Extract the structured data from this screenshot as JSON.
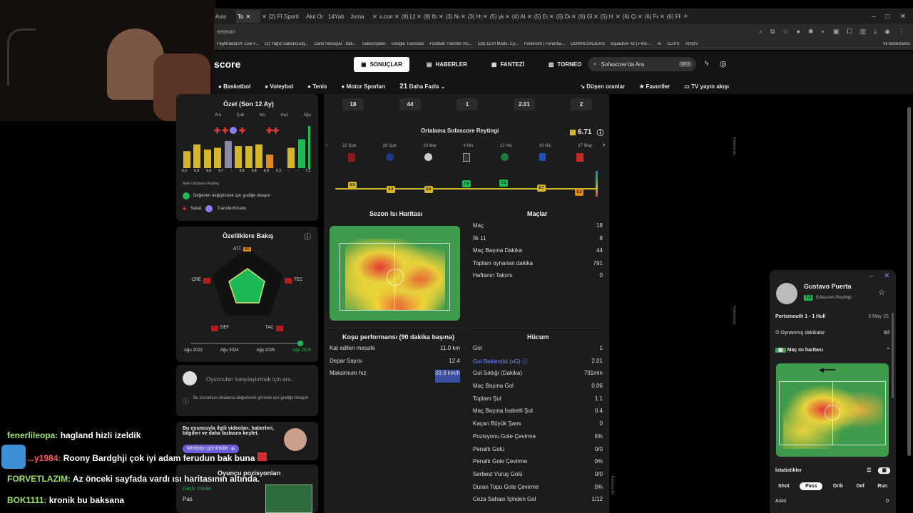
{
  "browser": {
    "tabs": [
      "Asis",
      "To",
      "(2) FF",
      "Sporti",
      "Akıl Or",
      "14Yab",
      "Juma",
      "x.com/",
      "(8) LEV",
      "(8) fbt",
      "(3) No",
      "(3) Hy",
      "(5) yky",
      "(4) Ale",
      "(5) Em",
      "(6) De",
      "(6) Gk",
      "(5) H",
      "(6) Çul",
      "(6) Fer",
      "(6) FF"
    ],
    "address": "season",
    "bookmarks": [
      "Flightradar24: Live F...",
      "(2) Yağız Sabuncuoğ...",
      "Canlı Sonuçlar - İddi...",
      "Subscription",
      "Google Translate",
      "Football Transfer Ru...",
      "(29) 1100 Mods. Cy...",
      "Fenerium | Fenerba...",
      "DOWNLOADERS",
      "Squadron 42 | First-...",
      "AI",
      "CLIPS",
      "ARŞİV",
      "All Bookmarks"
    ]
  },
  "site": {
    "logo": "score",
    "nav": {
      "results": "SONUÇLAR",
      "news": "HABERLER",
      "fantasy": "FANTEZİ",
      "tournament": "TORNEO"
    },
    "search_placeholder": "Sofascore'da Ara",
    "search_kbd": "Ctrl K",
    "sports": [
      "Basketbol",
      "Voleybol",
      "Tenis",
      "Motor Sporları"
    ],
    "more_count": "21",
    "more_label": "Daha Fazla",
    "right_links": [
      "Düşen oranlar",
      "Favoriler",
      "TV yayın akışı"
    ]
  },
  "summary": {
    "title": "Özet (Son 12 Ay)",
    "months": [
      "Ara",
      "Şub",
      "Nis",
      "Haz",
      "Ağu"
    ],
    "bar_values": [
      6.5,
      6.9,
      6.6,
      6.7,
      7.1,
      6.8,
      6.8,
      6.9,
      6.3,
      6.7,
      7.2
    ],
    "bar_labels": [
      "6.5",
      "6.9",
      "6.6",
      "6.7",
      "-",
      "6.8",
      "6.8",
      "6.9",
      "6.3",
      "-",
      "-",
      "7.2"
    ],
    "monthly_label": "Aylık Ortalama Reyting",
    "tap_hint": "Değerleri değiştirmek için grafiğe tıklayın",
    "legend_injury": "Sakat",
    "legend_transfer": "Transfer/Kiralık"
  },
  "attributes": {
    "title": "Özelliklere Bakış",
    "labels": {
      "att": "ATT",
      "tec": "TEC",
      "tac": "TAC",
      "def": "DEF",
      "cre": "CRE"
    },
    "att_value": "60",
    "timeline": [
      "Ağu 2023",
      "Ağu 2024",
      "Ağu 2025",
      "Ağu 2026"
    ]
  },
  "compare": {
    "placeholder": "Oyuncuları karşılaştırmak için ara...",
    "hint": "Bu konumun ortalama değerlerini görmek için grafiğe tıklayın"
  },
  "media": {
    "text": "Bu oyuncuyla ilgili videoları, haberleri, bilgileri ve daha fazlasını keşfet.",
    "button": "Medyayı görüntüle"
  },
  "positions": {
    "title": "Oyuncu pozisyonları",
    "strengths": "Güçlü Yönler",
    "item": "Pas"
  },
  "top_stats": [
    "18",
    "44",
    "1",
    "2.01",
    "2"
  ],
  "avg_rating": {
    "title": "Ortalama Sofascore Reytingi",
    "value": "6.71",
    "dates": [
      "22 Şub",
      "28 Şub",
      "20 Mar",
      "6 Nis",
      "12 Nis",
      "19 Nis",
      "17 May"
    ],
    "ratings": [
      "6.9",
      "6.6",
      "6.6",
      "7.0",
      "7.1",
      "6.7",
      "6.3"
    ]
  },
  "heatmap": {
    "title": "Sezon Isı Haritası"
  },
  "matches": {
    "title": "Maçlar",
    "rows": [
      {
        "label": "Maç",
        "value": "18"
      },
      {
        "label": "İlk 11",
        "value": "8"
      },
      {
        "label": "Maç Başına Dakika",
        "value": "44"
      },
      {
        "label": "Toplam oynanan dakika",
        "value": "791"
      },
      {
        "label": "Haftanın Takımı",
        "value": "0"
      }
    ]
  },
  "running": {
    "title": "Koşu performansı (90 dakika başına)",
    "rows": [
      {
        "label": "Kat edilen mesafe",
        "value": "11.0 km"
      },
      {
        "label": "Depar Sayısı",
        "value": "12.4"
      },
      {
        "label": "Maksimum hız",
        "value": "33.3 km/h"
      }
    ]
  },
  "attack": {
    "title": "Hücum",
    "rows": [
      {
        "label": "Gol",
        "value": "1"
      },
      {
        "label": "Gol Beklentisi (xG)",
        "value": "2.01"
      },
      {
        "label": "Gol Sıklığı (Dakika)",
        "value": "791min"
      },
      {
        "label": "Maç Başına Gol",
        "value": "0.06"
      },
      {
        "label": "Toplam Şut",
        "value": "1.1"
      },
      {
        "label": "Maç Başına İsabetli Şut",
        "value": "0.4"
      },
      {
        "label": "Kaçan Büyük Şans",
        "value": "0"
      },
      {
        "label": "Pozisyonu Gole Çevirme",
        "value": "5%"
      },
      {
        "label": "Penaltı Golü",
        "value": "0/0"
      },
      {
        "label": "Penaltı Gole Çevirme",
        "value": "0%"
      },
      {
        "label": "Serbest Vuruş Golü",
        "value": "0/0"
      },
      {
        "label": "Duran Topu Gole Çevirme",
        "value": "0%"
      },
      {
        "label": "Ceza Sahası İçinden Gol",
        "value": "1/12"
      }
    ]
  },
  "popup": {
    "player": "Gustavo Puerta",
    "rating": "7.3",
    "rating_label": "Sofascore Reytingi",
    "match": "Portsmouth 1 - 1 Hull",
    "date": "3 May 25",
    "minutes_label": "Oynanmış dakikalar",
    "minutes": "90'",
    "heatmap_label": "Maç ısı haritası",
    "stats_label": "İstatistikler",
    "tabs": [
      "Shot",
      "Pass",
      "Drib",
      "Def",
      "Run"
    ],
    "assist_label": "Asist",
    "assist": "0"
  },
  "ad_label": "Reklamcılık",
  "chat": [
    {
      "user": "fenerlileopa:",
      "msg": "hagland hizli izeldik"
    },
    {
      "user": "...y1984:",
      "msg": "Roony Bardghji çok iyi adam ferudun bak buna"
    },
    {
      "user": "FORVETLAZIM:",
      "msg": "Az önceki sayfada vardı ısı haritasının altında."
    },
    {
      "user": "BOK1111:",
      "msg": "kronik bu baksana"
    }
  ]
}
